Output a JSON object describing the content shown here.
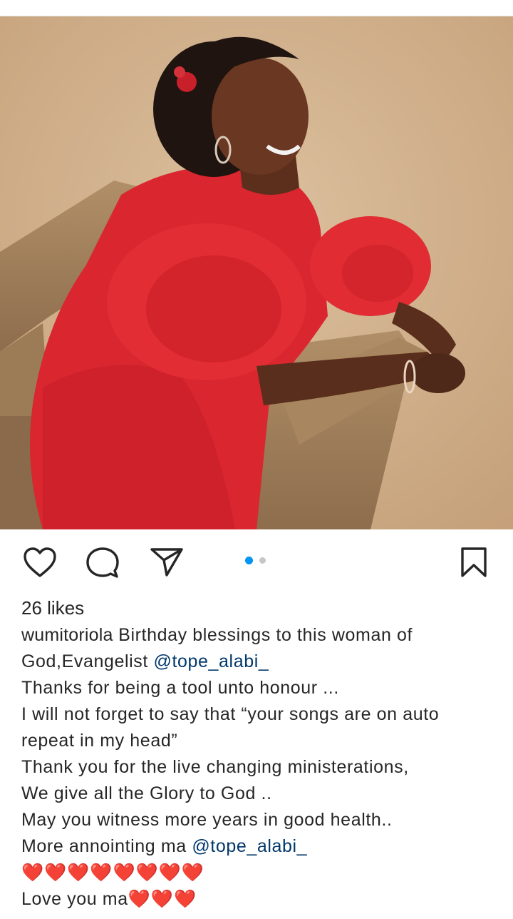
{
  "post": {
    "image_description_icon": "portrait-photo",
    "carousel": {
      "total": 2,
      "active": 1
    },
    "likes": "26 likes",
    "caption": {
      "username": "wumitoriola",
      "line1_text": " Birthday blessings to this woman of",
      "line2_text": "God,Evangelist ",
      "mention1": "@tope_alabi_",
      "line3": "Thanks for being a tool unto honour ...",
      "line4": "I will not forget to say that “your songs are on auto",
      "line5": "repeat in my head”",
      "line6": "Thank you for the live changing ministerations,",
      "line7": "We give all the Glory to God ..",
      "line8": "May you witness more years in good health..",
      "line9_text": "More annointing  ma ",
      "mention2": "@tope_alabi_",
      "line10": "❤️❤️❤️❤️❤️❤️❤️❤️",
      "line11_text": "Love you ma",
      "line11_hearts": "❤️❤️❤️"
    }
  },
  "colors": {
    "text": "#262626",
    "mention": "#00376b",
    "active_dot": "#0095f6",
    "inactive_dot": "#c7c7c7",
    "heart": "#e3262f"
  },
  "icons": {
    "like": "heart-icon",
    "comment": "comment-bubble-icon",
    "share": "paper-plane-icon",
    "save": "bookmark-icon"
  }
}
